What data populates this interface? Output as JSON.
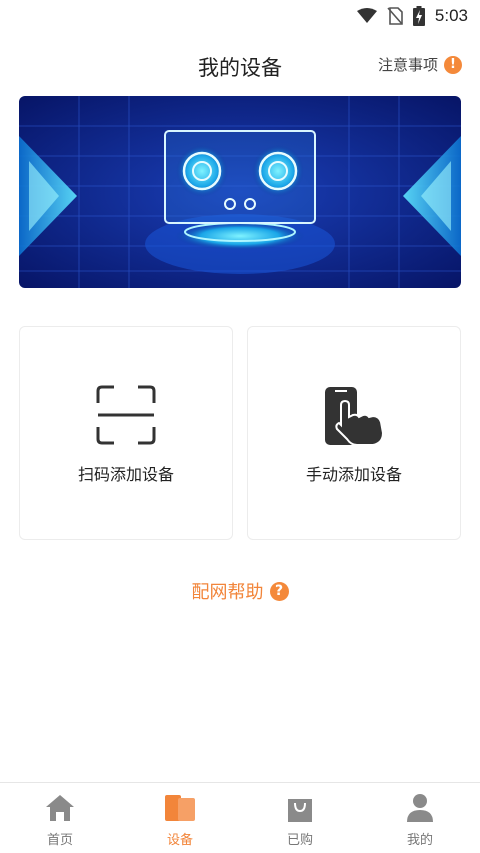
{
  "status_bar": {
    "time": "5:03",
    "icons": [
      "wifi-icon",
      "no-sim-icon",
      "battery-charging-icon"
    ]
  },
  "header": {
    "title": "我的设备",
    "notice_label": "注意事项",
    "notice_badge": "!"
  },
  "banner": {
    "image": "gas-stove-tech-banner"
  },
  "cards": {
    "scan_label": "扫码添加设备",
    "manual_label": "手动添加设备"
  },
  "help": {
    "label": "配网帮助",
    "badge": "?"
  },
  "tabs": [
    {
      "label": "首页",
      "icon": "home-icon",
      "active": false
    },
    {
      "label": "设备",
      "icon": "devices-icon",
      "active": true
    },
    {
      "label": "已购",
      "icon": "shopping-bag-icon",
      "active": false
    },
    {
      "label": "我的",
      "icon": "user-icon",
      "active": false
    }
  ],
  "colors": {
    "accent": "#f2853a",
    "banner_bg": "#0a1f7a",
    "banner_glow": "#33d6ff"
  }
}
